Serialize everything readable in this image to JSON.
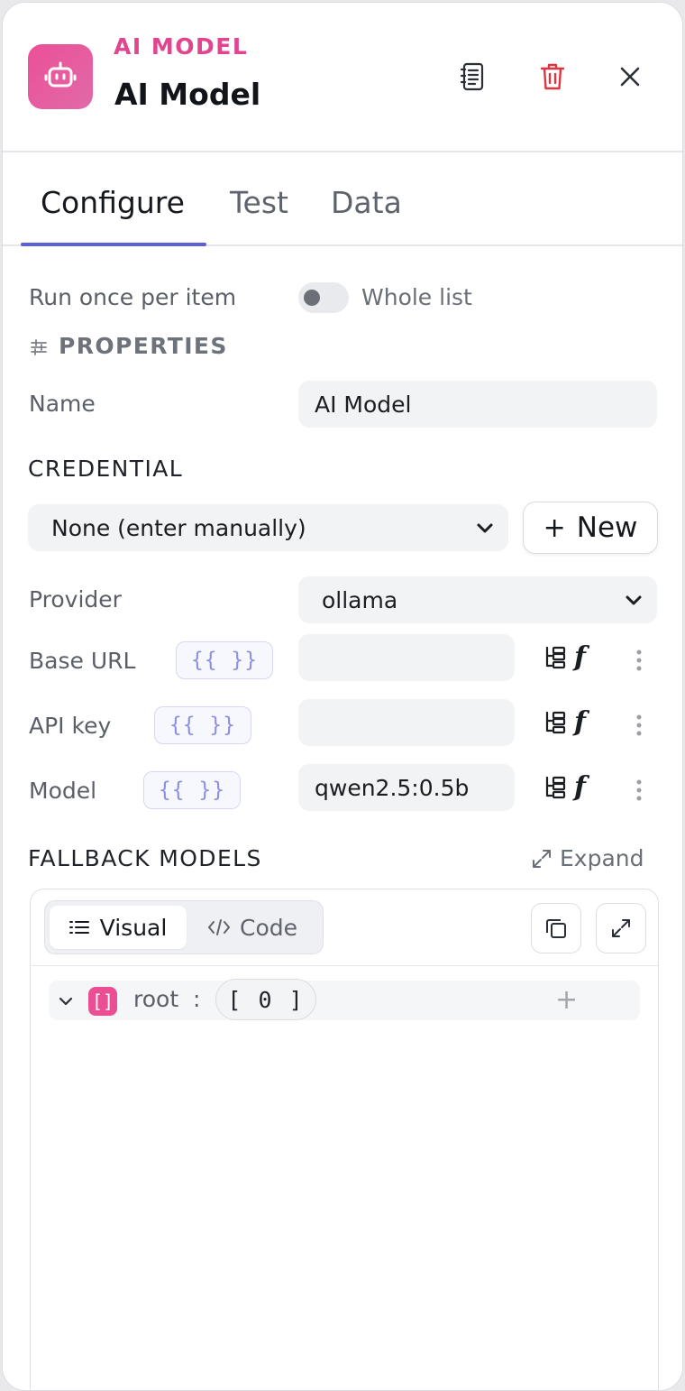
{
  "header": {
    "eyebrow": "AI MODEL",
    "title": "AI Model"
  },
  "tabs": [
    {
      "label": "Configure",
      "active": true
    },
    {
      "label": "Test",
      "active": false
    },
    {
      "label": "Data",
      "active": false
    }
  ],
  "run_mode": {
    "label": "Run once per item",
    "toggle_label": "Whole list",
    "whole_list_enabled": false
  },
  "properties": {
    "heading": "PROPERTIES",
    "name_label": "Name",
    "name_value": "AI Model"
  },
  "credential": {
    "heading": "CREDENTIAL",
    "selected": "None (enter manually)",
    "new_button": "New"
  },
  "fields": {
    "provider_label": "Provider",
    "provider_value": "ollama",
    "base_url_label": "Base URL",
    "base_url_value": "",
    "api_key_label": "API key",
    "api_key_value": "",
    "model_label": "Model",
    "model_value": "qwen2.5:0.5b",
    "expression_token": "{{ }}",
    "function_glyph": "f"
  },
  "fallback": {
    "heading": "FALLBACK MODELS",
    "expand_label": "Expand",
    "tabs": [
      {
        "label": "Visual",
        "active": true
      },
      {
        "label": "Code",
        "active": false
      }
    ],
    "tree": {
      "type_badge": "[]",
      "key": "root",
      "separator": ":",
      "count_label": "[ 0 ]"
    },
    "add_glyph": "+"
  },
  "colors": {
    "brand_pink": "#e0458f",
    "accent_indigo": "#5d5fd4",
    "danger_red": "#e0353f"
  },
  "icons": [
    "robot-icon",
    "notes-icon",
    "trash-icon",
    "close-icon",
    "sliders-icon",
    "chevron-down-icon",
    "plus-icon",
    "tree-structure-icon",
    "function-icon",
    "kebab-menu-icon",
    "expand-arrows-icon",
    "list-icon",
    "code-icon",
    "copy-icon",
    "fullscreen-icon"
  ]
}
